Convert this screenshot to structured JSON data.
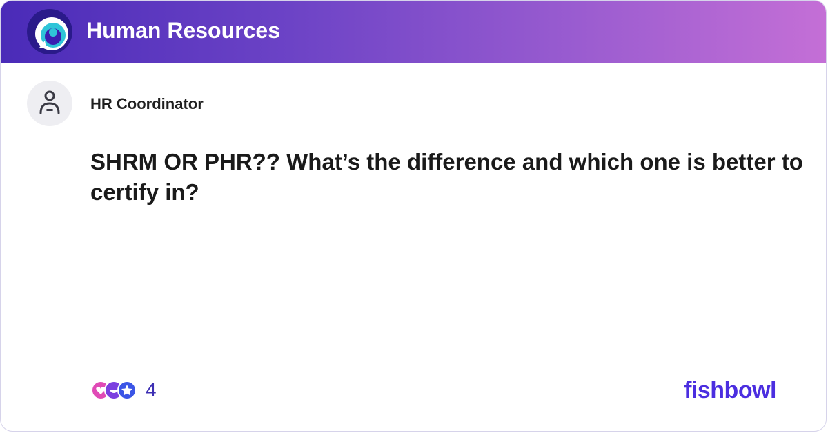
{
  "header": {
    "community_title": "Human Resources",
    "logo_icon": "fishbowl-bowl-icon"
  },
  "post": {
    "author": "HR Coordinator",
    "avatar_icon": "person-icon",
    "question": "SHRM OR PHR?? What’s the difference and which one is better to certify in?"
  },
  "footer": {
    "reaction_icons": [
      "heart-reaction-icon",
      "laugh-reaction-icon",
      "star-reaction-icon"
    ],
    "reaction_count": "4",
    "brand": "fishbowl"
  },
  "colors": {
    "header_gradient_start": "#4a2bb8",
    "header_gradient_end": "#c46fd6",
    "brand": "#4b2ee0",
    "count": "#3d2fb3"
  }
}
